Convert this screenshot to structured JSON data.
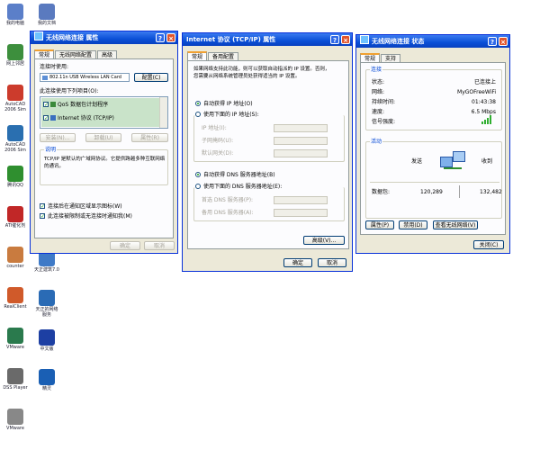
{
  "desktop_icons": [
    {
      "name": "我的电脑",
      "color": "#5b7fc9"
    },
    {
      "name": "网上邻居",
      "color": "#3d8f3d"
    },
    {
      "name": "AutoCAD 2006 Sim",
      "color": "#cc3b2c"
    },
    {
      "name": "AutoCAD 2006 Sim",
      "color": "#2a6fb0"
    },
    {
      "name": "腾讯QQ",
      "color": "#2f8f2f"
    },
    {
      "name": "ATI催化剂",
      "color": "#c12727"
    },
    {
      "name": "counter",
      "color": "#c97b3f"
    },
    {
      "name": "RealClient",
      "color": "#d05a2a"
    },
    {
      "name": "VMware",
      "color": "#2a7a4d"
    },
    {
      "name": "DSS Player",
      "color": "#6a6a6a"
    },
    {
      "name": "VMware",
      "color": "#888888"
    }
  ],
  "desktop_icons_col2": [
    {
      "name": "我的文档",
      "color": "#5a7abf"
    },
    {
      "name": "天正建筑7.0",
      "color": "#3f7ac7"
    },
    {
      "name": "天正的网络服务",
      "color": "#2a6bb5"
    },
    {
      "name": "中文版",
      "color": "#1d3fa3"
    },
    {
      "name": "精灵",
      "color": "#1a5fb4"
    }
  ],
  "win1": {
    "title": "无线网络连接 属性",
    "tabs": [
      "常规",
      "无线网络配置",
      "高级"
    ],
    "connect_using": "连接时使用:",
    "adapter": "802.11n USB Wireless LAN Card",
    "configure": "配置(C)",
    "items_label": "此连接使用下列项目(O):",
    "items": [
      "QoS 数据包计划程序",
      "Internet 协议 (TCP/IP)"
    ],
    "install": "安装(N)...",
    "uninstall": "卸载(U)",
    "properties": "属性(R)",
    "desc_title": "说明",
    "desc_text1": "TCP/IP 是默认的广域网协议。它提供跨越多种互联网络",
    "desc_text2": "的通讯。",
    "chk_show": "连接后在通知区域显示图标(W)",
    "chk_notify": "此连接被限制或无连接时通知我(M)",
    "ok": "确定",
    "cancel": "取消"
  },
  "win2": {
    "title": "Internet 协议 (TCP/IP) 属性",
    "tabs": [
      "常规",
      "备用配置"
    ],
    "info1": "如果网络支持此功能，则可以获取自动指派的 IP 设置。否则，",
    "info2": "您需要从网络系统管理员处获得适当的 IP 设置。",
    "auto_ip": "自动获得 IP 地址(O)",
    "manual_ip": "使用下面的 IP 地址(S):",
    "ip": "IP 地址(I):",
    "mask": "子网掩码(U):",
    "gateway": "默认网关(D):",
    "auto_dns": "自动获得 DNS 服务器地址(B)",
    "manual_dns": "使用下面的 DNS 服务器地址(E):",
    "dns1": "首选 DNS 服务器(P):",
    "dns2": "备用 DNS 服务器(A):",
    "advanced": "高级(V)...",
    "ok": "确定",
    "cancel": "取消"
  },
  "win3": {
    "title": "无线网络连接 状态",
    "tabs": [
      "常规",
      "支持"
    ],
    "conn_group": "连接",
    "rows": [
      {
        "k": "状态:",
        "v": "已连接上"
      },
      {
        "k": "网络:",
        "v": "MyGOFreeWiFi"
      },
      {
        "k": "持续时间:",
        "v": "01:43:38"
      },
      {
        "k": "速度:",
        "v": "6.5 Mbps"
      },
      {
        "k": "信号强度:",
        "v": ""
      }
    ],
    "activity": "活动",
    "sent": "发送",
    "recv": "收到",
    "packets": "数据包:",
    "sent_val": "120,289",
    "recv_val": "132,482",
    "prop": "属性(P)",
    "disable": "禁用(D)",
    "view_networks": "查看无线网络(V)",
    "close": "关闭(C)"
  }
}
